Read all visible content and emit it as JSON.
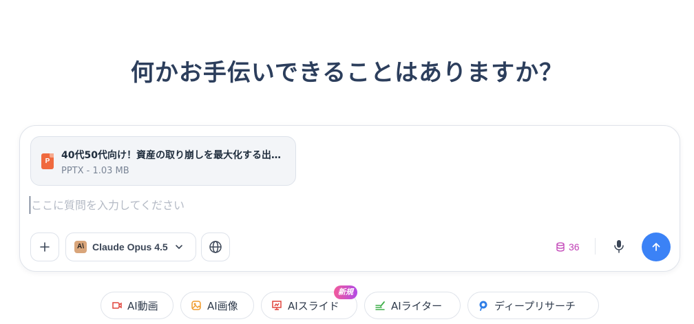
{
  "headline": "何かお手伝いできることはありますか？",
  "attachment": {
    "icon": "pptx-file-icon",
    "icon_letter": "P",
    "file_name": "40代50代向け！資産の取り崩しを最大化する出…",
    "file_meta": "PPTX - 1.03 MB"
  },
  "composer": {
    "placeholder": "ここに質問を入力してください",
    "value": ""
  },
  "toolbar": {
    "model_logo": "A\\",
    "model_label": "Claude Opus 4.5",
    "credits": "36"
  },
  "chips": [
    {
      "label": "AI動画",
      "icon": "video-icon"
    },
    {
      "label": "AI画像",
      "icon": "image-icon"
    },
    {
      "label": "AIスライド",
      "icon": "slide-icon",
      "badge": "新規"
    },
    {
      "label": "AIライター",
      "icon": "writer-icon"
    },
    {
      "label": "ディープリサーチ",
      "icon": "research-icon"
    }
  ],
  "colors": {
    "accent": "#3b82f6",
    "credits": "#c03fb5",
    "headline": "#2c3e5c"
  }
}
